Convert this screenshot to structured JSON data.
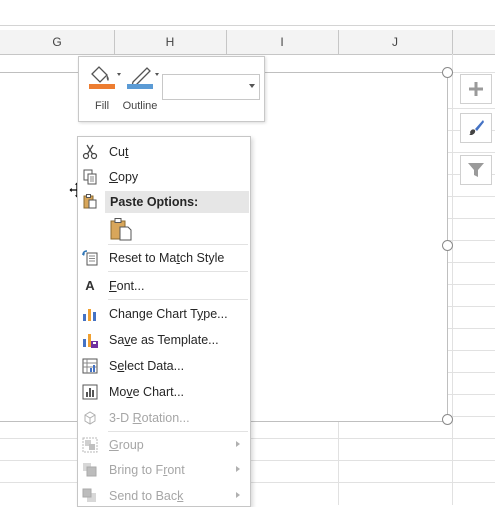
{
  "columns": [
    "G",
    "H",
    "I",
    "J"
  ],
  "format_toolbar": {
    "fill_label": "Fill",
    "outline_label": "Outline",
    "element_selector_value": "",
    "fill_color": "#ed7d31",
    "outline_color": "#5b9bd5"
  },
  "side_buttons": [
    "chart-elements-plus-icon",
    "chart-styles-brush-icon",
    "chart-filters-funnel-icon"
  ],
  "context_menu": {
    "cut": {
      "pre": "Cu",
      "key": "t",
      "post": ""
    },
    "copy": {
      "pre": "",
      "key": "C",
      "post": "opy"
    },
    "paste_options": "Paste Options:",
    "reset": {
      "pre": "Reset to Ma",
      "key": "t",
      "post": "ch Style"
    },
    "font": {
      "pre": "",
      "key": "F",
      "post": "ont..."
    },
    "change_type": {
      "pre": "Change Chart T",
      "key": "y",
      "post": "pe..."
    },
    "save_template": {
      "pre": "Sa",
      "key": "v",
      "post": "e as Template..."
    },
    "select_data": {
      "pre": "S",
      "key": "e",
      "post": "lect Data..."
    },
    "move_chart": {
      "pre": "Mo",
      "key": "v",
      "post": "e Chart..."
    },
    "rotation": {
      "pre": "3-D ",
      "key": "R",
      "post": "otation..."
    },
    "group": {
      "pre": "",
      "key": "G",
      "post": "roup"
    },
    "bring_front": {
      "pre": "Bring to F",
      "key": "r",
      "post": "ont"
    },
    "send_back": {
      "pre": "Send to Bac",
      "key": "k",
      "post": ""
    }
  }
}
